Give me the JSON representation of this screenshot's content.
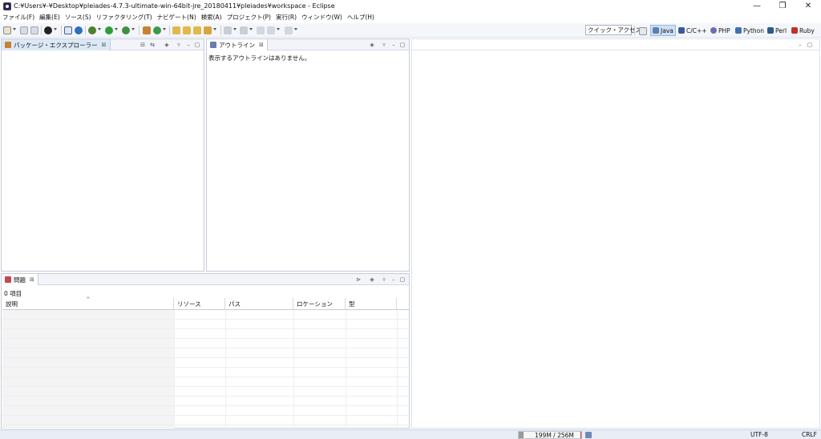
{
  "window": {
    "title": "C:¥Users¥-¥Desktop¥pleiades-4.7.3-ultimate-win-64bit-jre_20180411¥pleiades¥workspace - Eclipse",
    "controls": [
      "—",
      "❐",
      "✕"
    ]
  },
  "menu": [
    "ファイル(F)",
    "編集(E)",
    "ソース(S)",
    "リファクタリング(T)",
    "ナビゲート(N)",
    "検索(A)",
    "プロジェクト(P)",
    "実行(R)",
    "ウィンドウ(W)",
    "ヘルプ(H)"
  ],
  "toolbar": {
    "quick_access": "クイック・アクセス",
    "perspectives": [
      "Java",
      "C/C++",
      "PHP",
      "Python",
      "Perl",
      "Ruby"
    ],
    "active_perspective": "Java"
  },
  "package_explorer": {
    "tab_label": "パッケージ・エクスプローラー"
  },
  "outline": {
    "tab_label": "アウトライン",
    "message": "表示するアウトラインはありません。"
  },
  "problems": {
    "tab_label": "問題",
    "count": "0 項目",
    "columns": [
      "説明",
      "リソース",
      "パス",
      "ロケーション",
      "型"
    ]
  },
  "status": {
    "memory": "199M / 256M",
    "encoding": "UTF-8",
    "line_ending": "CRLF"
  },
  "colors": {
    "active_tab": "#dbe8f7",
    "accent": "#2c2255"
  }
}
